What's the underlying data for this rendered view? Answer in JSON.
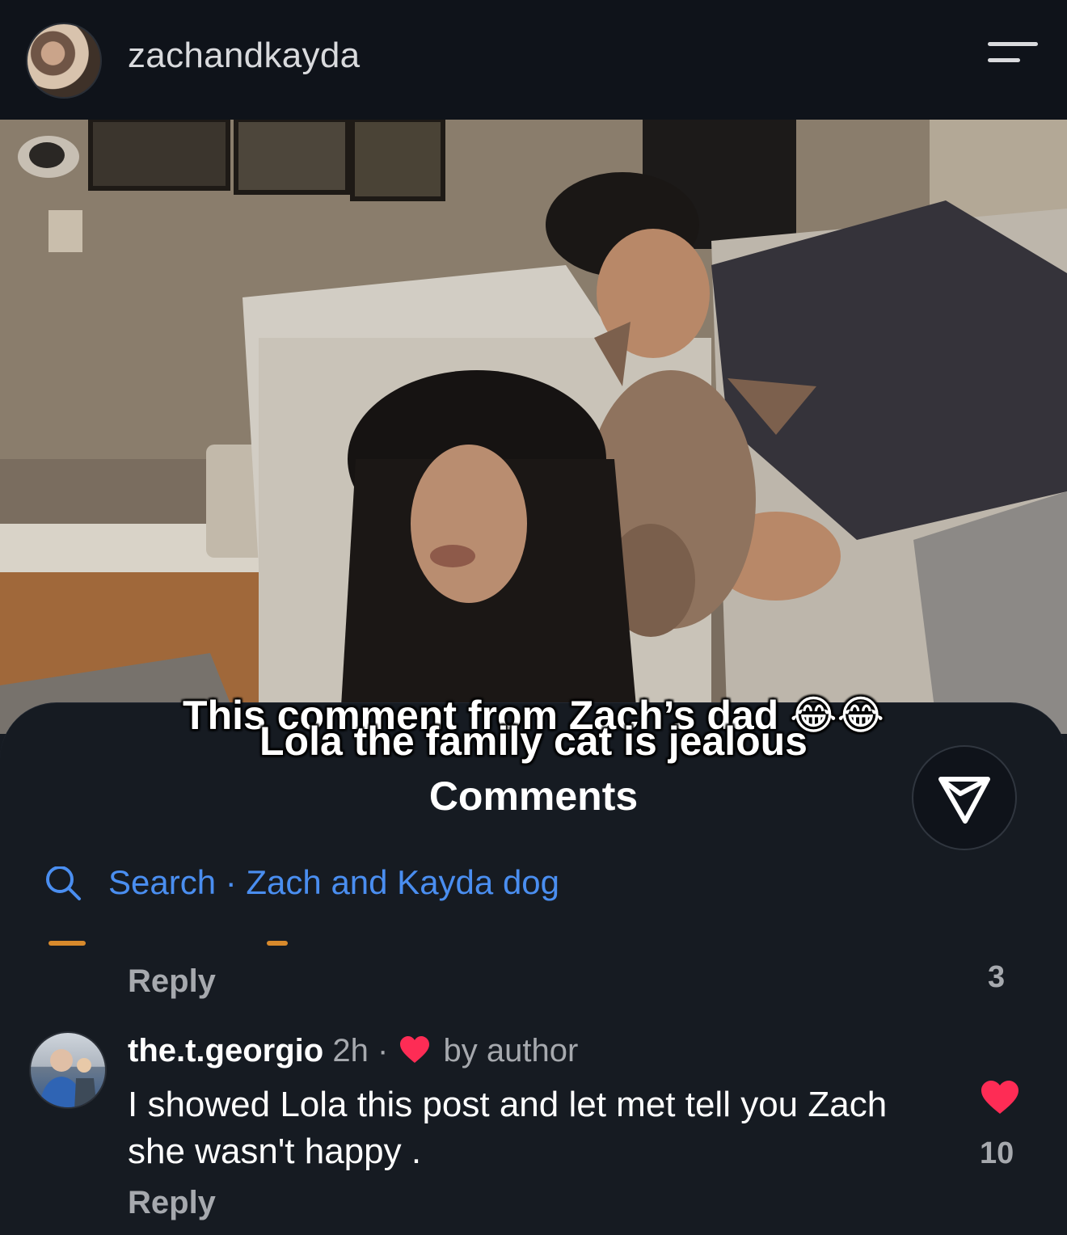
{
  "header": {
    "username": "zachandkayda"
  },
  "video": {
    "overlay_line1": "This comment from Zach’s dad 😂😂",
    "overlay_line2": "Lola the family cat is jealous"
  },
  "comments_panel": {
    "title": "Comments",
    "search_text": "Search · Zach and Kayda dog",
    "previous_comment": {
      "reply_label": "Reply",
      "like_count": "3"
    },
    "comment": {
      "username": "the.t.georgio",
      "time": "2h",
      "separator": "·",
      "author_liked_label": "by author",
      "text": "I showed Lola this post and let met tell you Zach she wasn't happy .",
      "like_count": "10",
      "reply_label": "Reply"
    }
  },
  "colors": {
    "background": "#161b22",
    "topbar": "#0f131a",
    "link_blue": "#4a8ef0",
    "like_red": "#fe2c55",
    "muted_text": "#a6a9ae"
  },
  "icons": [
    "menu-icon",
    "share-send-icon",
    "search-icon",
    "heart-icon"
  ]
}
